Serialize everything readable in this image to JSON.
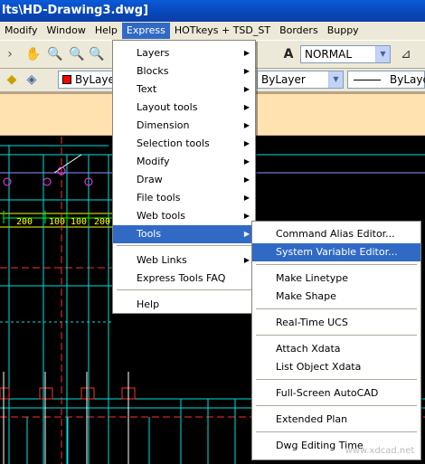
{
  "window": {
    "title": "lts\\HD-Drawing3.dwg]"
  },
  "menubar": {
    "items": [
      "Modify",
      "Window",
      "Help",
      "Express",
      "HOTkeys + TSD_ST",
      "Borders",
      "Buppy"
    ]
  },
  "toolbar": {
    "textstyle": "NORMAL",
    "layer": "ByLayer",
    "linetype": "ByLayer",
    "lineweight": "ByLayer"
  },
  "drawing": {
    "dimensions": [
      "200",
      "100",
      "100",
      "200"
    ]
  },
  "express_menu": {
    "items": [
      {
        "label": "Layers"
      },
      {
        "label": "Blocks"
      },
      {
        "label": "Text"
      },
      {
        "label": "Layout tools"
      },
      {
        "label": "Dimension"
      },
      {
        "label": "Selection tools"
      },
      {
        "label": "Modify"
      },
      {
        "label": "Draw"
      },
      {
        "label": "File tools"
      },
      {
        "label": "Web tools"
      },
      {
        "label": "Tools"
      },
      {
        "label": "Web Links"
      },
      {
        "label": "Express Tools FAQ"
      },
      {
        "label": "Help"
      }
    ]
  },
  "tools_submenu": {
    "items": [
      {
        "label": "Command Alias Editor..."
      },
      {
        "label": "System Variable Editor..."
      },
      {
        "label": "Make Linetype"
      },
      {
        "label": "Make Shape"
      },
      {
        "label": "Real-Time UCS"
      },
      {
        "label": "Attach Xdata"
      },
      {
        "label": "List Object Xdata"
      },
      {
        "label": "Full-Screen AutoCAD"
      },
      {
        "label": "Extended Plan"
      },
      {
        "label": "Dwg Editing Time"
      }
    ]
  },
  "watermark": {
    "text": "www.xdcad.net"
  },
  "colors": {
    "highlight": "#316ac5",
    "menubar": "#ece9d8",
    "band": "#ffe2b0",
    "layer_swatch": "#ff0000"
  }
}
